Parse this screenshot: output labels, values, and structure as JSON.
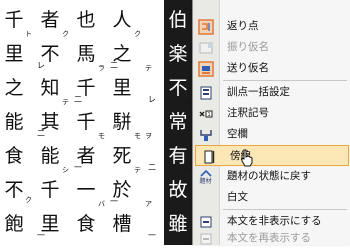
{
  "document": {
    "columns": [
      [
        "伯",
        "楽",
        "不",
        "常",
        "有",
        "故",
        "雖"
      ],
      [
        "人",
        "之",
        "里",
        "駢",
        "死",
        "於",
        "槽"
      ],
      [
        "也",
        "馬",
        "千",
        "千",
        "者",
        "一",
        "食"
      ],
      [
        "者",
        "不",
        "知",
        "其",
        "能",
        "千",
        "里"
      ],
      [
        "千",
        "里",
        "之",
        "能",
        "食",
        "不",
        "飽"
      ]
    ],
    "readings": [
      "ト",
      "ク",
      "ク",
      "テ",
      "シ",
      "ラ",
      "モ",
      "バ",
      "ク",
      "モ",
      "テ",
      "テ",
      "ヲ",
      "ア",
      "リ",
      "ハ"
    ],
    "marks": [
      "レ",
      "二",
      "一",
      "二",
      "一",
      "二",
      "一",
      "レ",
      "二",
      "一"
    ]
  },
  "context_menu": {
    "items": [
      {
        "label": "返り点",
        "icon": "return-mark-icon",
        "enabled": true
      },
      {
        "label": "振り仮名",
        "icon": "furigana-icon",
        "enabled": false
      },
      {
        "label": "送り仮名",
        "icon": "okurigana-icon",
        "enabled": true
      },
      {
        "label": "訓点一括設定",
        "icon": "kunten-batch-icon",
        "enabled": true
      },
      {
        "label": "注釈記号",
        "icon": "annotation-mark-icon",
        "enabled": true
      },
      {
        "label": "空欄",
        "icon": "blank-icon",
        "enabled": true
      },
      {
        "label": "傍線",
        "icon": "side-line-icon",
        "enabled": true,
        "highlighted": true
      },
      {
        "label": "題材の状態に戻す",
        "icon": "restore-icon",
        "enabled": true
      },
      {
        "label": "白文",
        "icon": "plain-text-icon",
        "enabled": true
      },
      {
        "label": "本文を非表示にする",
        "icon": "hide-text-icon",
        "enabled": true
      },
      {
        "label": "本文を再表示する",
        "icon": "show-text-icon",
        "enabled": false
      }
    ],
    "icon_labels": {
      "restore": "題材"
    }
  },
  "colors": {
    "selection": "#1a1a1a",
    "highlight_fill": "#fbe6b6",
    "highlight_border": "#e9a740",
    "icon_orange": "#e07a3a",
    "icon_blue": "#2f5fb3"
  }
}
